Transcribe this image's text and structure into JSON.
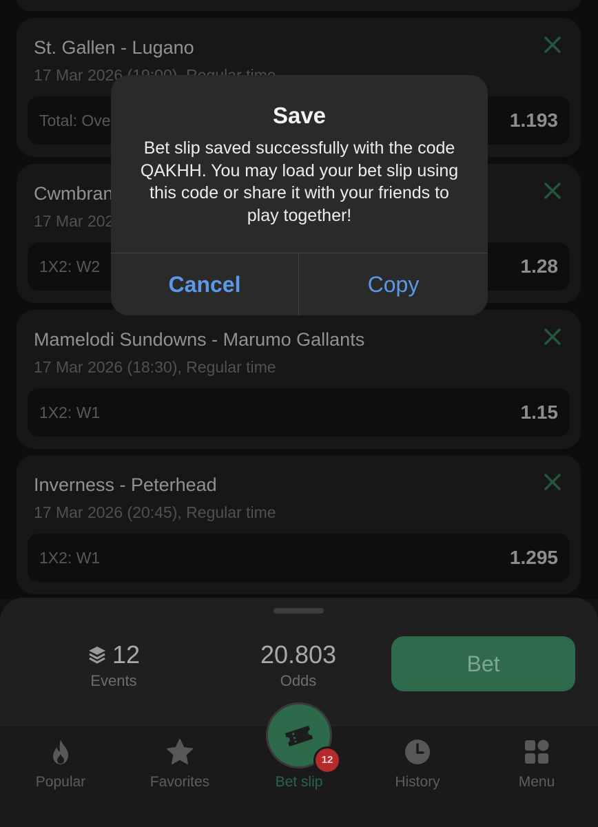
{
  "bets": [
    {
      "match": "St. Gallen - Lugano",
      "when": "17 Mar 2026 (19:00), Regular time",
      "market": "Total: Over",
      "odd": "1.193"
    },
    {
      "match": "Cwmbran",
      "when": "17 Mar 2026",
      "market": "1X2: W2",
      "odd": "1.28"
    },
    {
      "match": "Mamelodi Sundowns - Marumo Gallants",
      "when": "17 Mar 2026 (18:30), Regular time",
      "market": "1X2: W1",
      "odd": "1.15"
    },
    {
      "match": "Inverness - Peterhead",
      "when": "17 Mar 2026 (20:45), Regular time",
      "market": "1X2: W1",
      "odd": "1.295"
    }
  ],
  "dialog": {
    "title": "Save",
    "message": "Bet slip saved successfully with the code QAKHH. You may load your bet slip using this code or share it with your friends to play together!",
    "cancel_label": "Cancel",
    "copy_label": "Copy"
  },
  "summary": {
    "events_count": "12",
    "events_label": "Events",
    "odds_value": "20.803",
    "odds_label": "Odds",
    "bet_label": "Bet"
  },
  "tabs": [
    {
      "label": "Popular",
      "icon": "flame-icon"
    },
    {
      "label": "Favorites",
      "icon": "star-icon"
    },
    {
      "label": "Bet slip",
      "icon": "ticket-icon",
      "badge": "12"
    },
    {
      "label": "History",
      "icon": "clock-icon"
    },
    {
      "label": "Menu",
      "icon": "grid-icon"
    }
  ],
  "colors": {
    "accent_green": "#2e6a4b",
    "remove_green": "#2f7a55",
    "link_blue": "#5b99e8",
    "badge_red": "#b52b2b"
  }
}
